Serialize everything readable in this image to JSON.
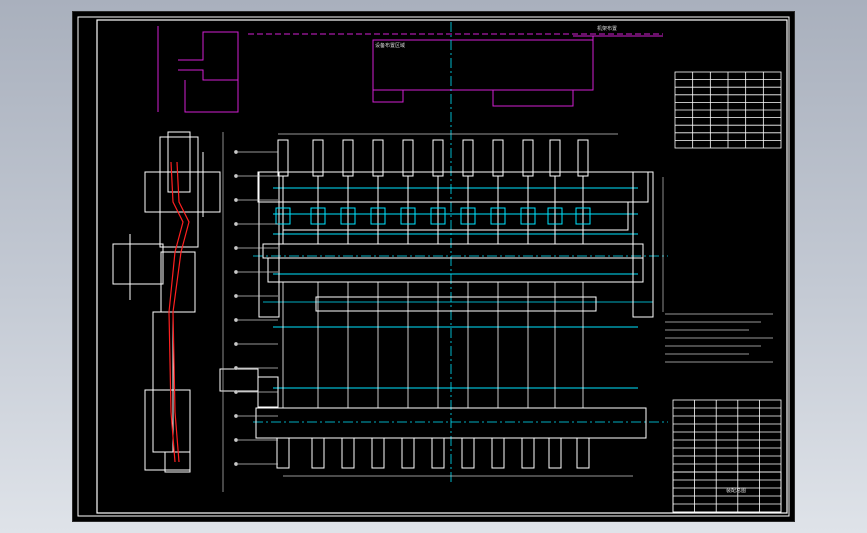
{
  "drawing": {
    "top_labels": [
      "设备布置区域",
      "机架布置"
    ],
    "title_block": "装配总图",
    "accent_colors": {
      "background": "#000000",
      "frame": "#ffffff",
      "parts": "#ffffff",
      "centerlines": "#00e5ff",
      "layout": "#d21fd2",
      "section": "#ff2020",
      "dimensions": "#c8c8c8"
    }
  }
}
